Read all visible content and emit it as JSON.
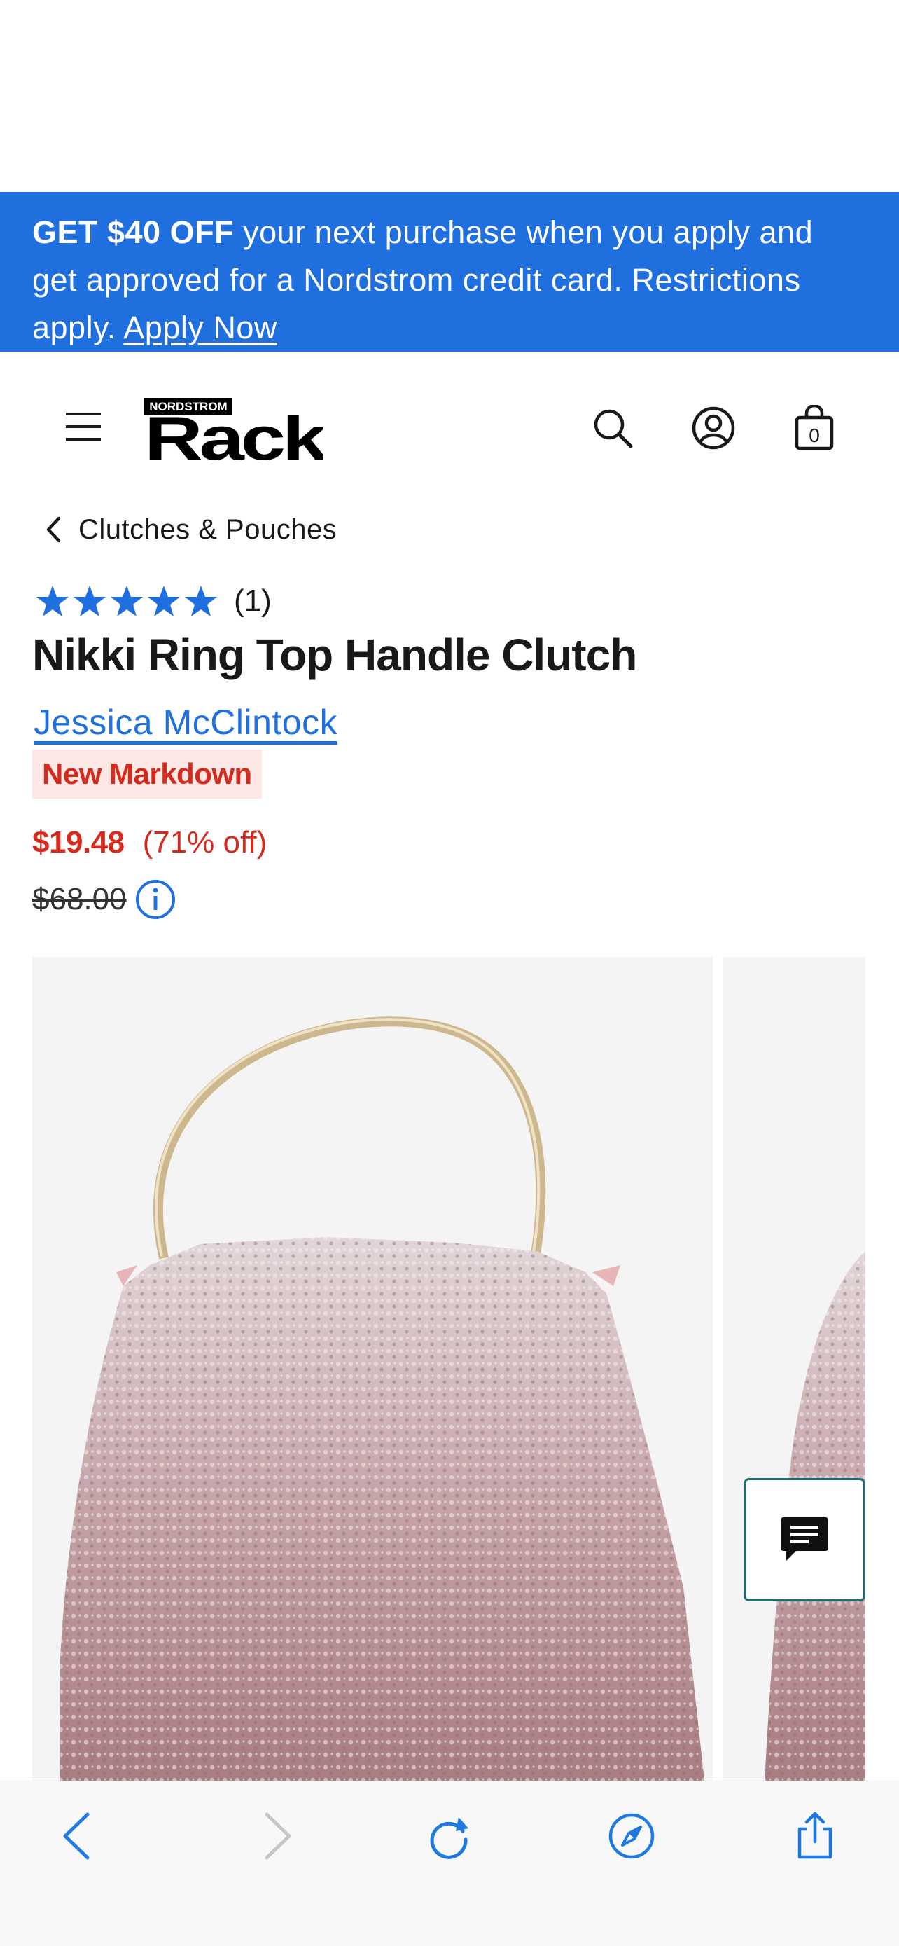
{
  "promo": {
    "bold": "GET $40 OFF",
    "text": " your next purchase when you apply and get approved for a Nordstrom credit card. Restrictions apply. ",
    "link": "Apply Now"
  },
  "header": {
    "logo_small": "NORDSTROM",
    "logo_big": "Rack"
  },
  "breadcrumb": {
    "label": "Clutches & Pouches"
  },
  "rating": {
    "stars": 5,
    "count": "(1)"
  },
  "product": {
    "title": "Nikki Ring Top Handle Clutch",
    "brand": "Jessica McClintock",
    "badge": "New Markdown",
    "price": "$19.48",
    "discount": "(71% off)",
    "original_price": "$68.00"
  },
  "colors": {
    "promo_bg": "#1f6fde",
    "link_blue": "#1f6fde",
    "sale_red": "#d52b1e",
    "badge_bg": "#fde8e6",
    "chat_border": "#1a6e73"
  },
  "icons": [
    "menu-icon",
    "search-icon",
    "account-icon",
    "bag-icon",
    "chevron-left-icon",
    "star-icon",
    "info-icon",
    "chat-icon",
    "back-icon",
    "forward-icon",
    "reload-icon",
    "compass-icon",
    "share-icon"
  ],
  "toolbar": {
    "bag_count": "0"
  }
}
